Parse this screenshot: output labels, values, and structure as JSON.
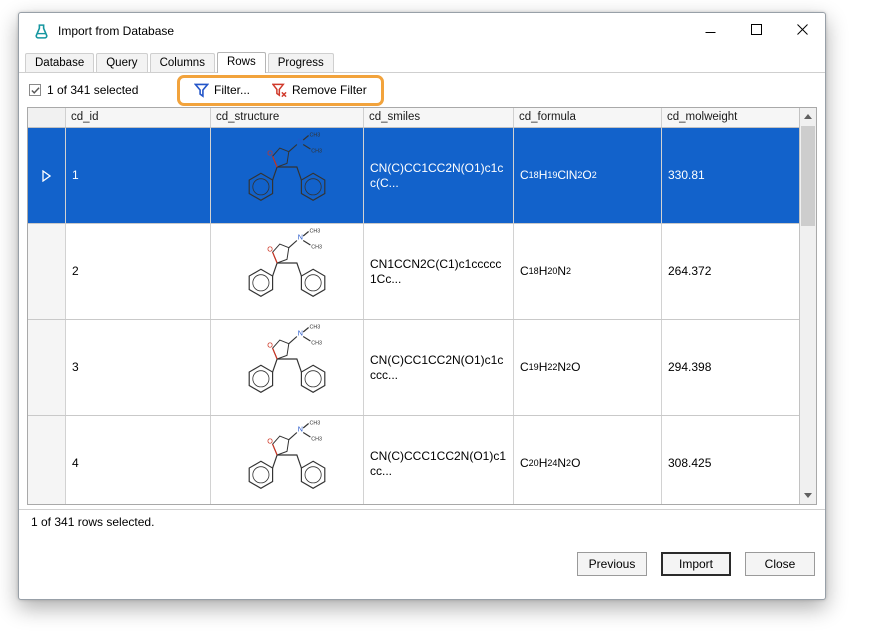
{
  "window": {
    "title": "Import from Database"
  },
  "tabs": [
    {
      "label": "Database",
      "active": false
    },
    {
      "label": "Query",
      "active": false
    },
    {
      "label": "Columns",
      "active": false
    },
    {
      "label": "Rows",
      "active": true
    },
    {
      "label": "Progress",
      "active": false
    }
  ],
  "toolbar": {
    "selection_label": "1 of 341 selected",
    "selection_checked": true,
    "filter_label": "Filter...",
    "remove_filter_label": "Remove Filter"
  },
  "table": {
    "columns": [
      {
        "key": "cd_id",
        "label": "cd_id"
      },
      {
        "key": "cd_structure",
        "label": "cd_structure"
      },
      {
        "key": "cd_smiles",
        "label": "cd_smiles"
      },
      {
        "key": "cd_formula",
        "label": "cd_formula"
      },
      {
        "key": "cd_molweight",
        "label": "cd_molweight"
      }
    ],
    "rows": [
      {
        "cd_id": "1",
        "cd_smiles": "CN(C)CC1CC2N(O1)c1cc(C...",
        "cd_formula": "C18H19ClN2O2",
        "cd_molweight": "330.81",
        "selected": true
      },
      {
        "cd_id": "2",
        "cd_smiles": "CN1CCN2C(C1)c1ccccc1Cc...",
        "cd_formula": "C18H20N2",
        "cd_molweight": "264.372",
        "selected": false
      },
      {
        "cd_id": "3",
        "cd_smiles": "CN(C)CC1CC2N(O1)c1cccc...",
        "cd_formula": "C19H22N2O",
        "cd_molweight": "294.398",
        "selected": false
      },
      {
        "cd_id": "4",
        "cd_smiles": "CN(C)CCC1CC2N(O1)c1cc...",
        "cd_formula": "C20H24N2O",
        "cd_molweight": "308.425",
        "selected": false
      }
    ]
  },
  "status_bar": {
    "text": "1 of 341 rows selected."
  },
  "footer": {
    "previous_label": "Previous",
    "import_label": "Import",
    "close_label": "Close"
  },
  "colors": {
    "selection_blue": "#1262cb",
    "annotation_orange": "#f2a33c",
    "filter_icon_blue": "#2456c9",
    "remove_filter_icon_red": "#d03a2b",
    "app_icon_teal": "#1596a0"
  }
}
